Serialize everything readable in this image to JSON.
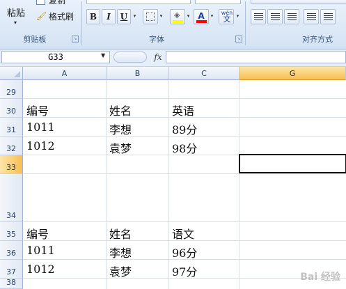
{
  "ribbon": {
    "clipboard": {
      "paste_label": "粘贴",
      "copy_label": "复制",
      "format_painter_label": "格式刷",
      "group_label": "剪贴板"
    },
    "font": {
      "group_label": "字体",
      "bold": "B",
      "italic": "I",
      "underline": "U",
      "font_color_glyph": "A",
      "wen_glyph": "wén\n文",
      "highlight_color": "#ffff00",
      "font_color": "#ff0000"
    },
    "alignment": {
      "group_label": "对齐方式"
    }
  },
  "formula_bar": {
    "name_box": "G33",
    "fx_label": "fx",
    "formula_value": ""
  },
  "columns": [
    {
      "label": "",
      "active": false
    },
    {
      "label": "A",
      "active": false
    },
    {
      "label": "B",
      "active": false
    },
    {
      "label": "C",
      "active": false
    },
    {
      "label": "G",
      "active": true
    }
  ],
  "rows": [
    {
      "label": "29",
      "active": false
    },
    {
      "label": "30",
      "active": false
    },
    {
      "label": "31",
      "active": false
    },
    {
      "label": "32",
      "active": false
    },
    {
      "label": "33",
      "active": true
    },
    {
      "label": "34",
      "active": false
    },
    {
      "label": "35",
      "active": false
    },
    {
      "label": "36",
      "active": false
    },
    {
      "label": "37",
      "active": false
    },
    {
      "label": "38",
      "active": false
    }
  ],
  "cells": {
    "r30": [
      "编号",
      "姓名",
      "英语"
    ],
    "r31": [
      "1011",
      "李想",
      "89分"
    ],
    "r32": [
      "1012",
      "袁梦",
      "98分"
    ],
    "r35": [
      "编号",
      "姓名",
      "语文"
    ],
    "r36": [
      "1011",
      "李想",
      "96分"
    ],
    "r37": [
      "1012",
      "袁梦",
      "97分"
    ]
  },
  "watermark": "Bai 经验",
  "colors": {
    "active_header": "#f7bf52",
    "ribbon_label": "#35537a",
    "grid_line": "#dadfe6"
  }
}
